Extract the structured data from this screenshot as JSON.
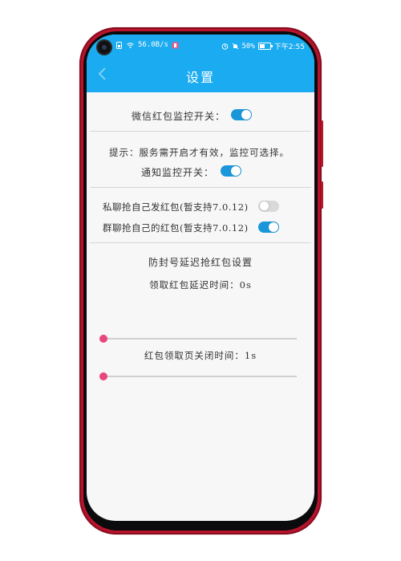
{
  "status_bar": {
    "network_speed": "56.0B/s",
    "battery": "50%",
    "time": "下午2:55"
  },
  "app_bar": {
    "title": "设置"
  },
  "settings": {
    "wechat_monitor_label": "微信红包监控开关：",
    "wechat_monitor_on": true,
    "hint_text": "提示：服务需开启才有效，监控可选择。",
    "notification_monitor_label": "通知监控开关：",
    "notification_monitor_on": true,
    "private_chat_label": "私聊抢自己发红包(暂支持7.0.12)",
    "private_chat_on": false,
    "group_chat_label": "群聊抢自己的红包(暂支持7.0.12)",
    "group_chat_on": true,
    "anti_ban_title": "防封号延迟抢红包设置",
    "receive_delay_label": "领取红包延迟时间：",
    "receive_delay_value": "0s",
    "receive_delay_fraction": 0,
    "close_time_label": "红包领取页关闭时间：",
    "close_time_value": "1s",
    "close_time_fraction": 0
  },
  "colors": {
    "accent": "#1aabf0",
    "toggle_on": "#1a97d9",
    "slider_thumb": "#e8477b",
    "phone_frame": "#b8142c"
  }
}
